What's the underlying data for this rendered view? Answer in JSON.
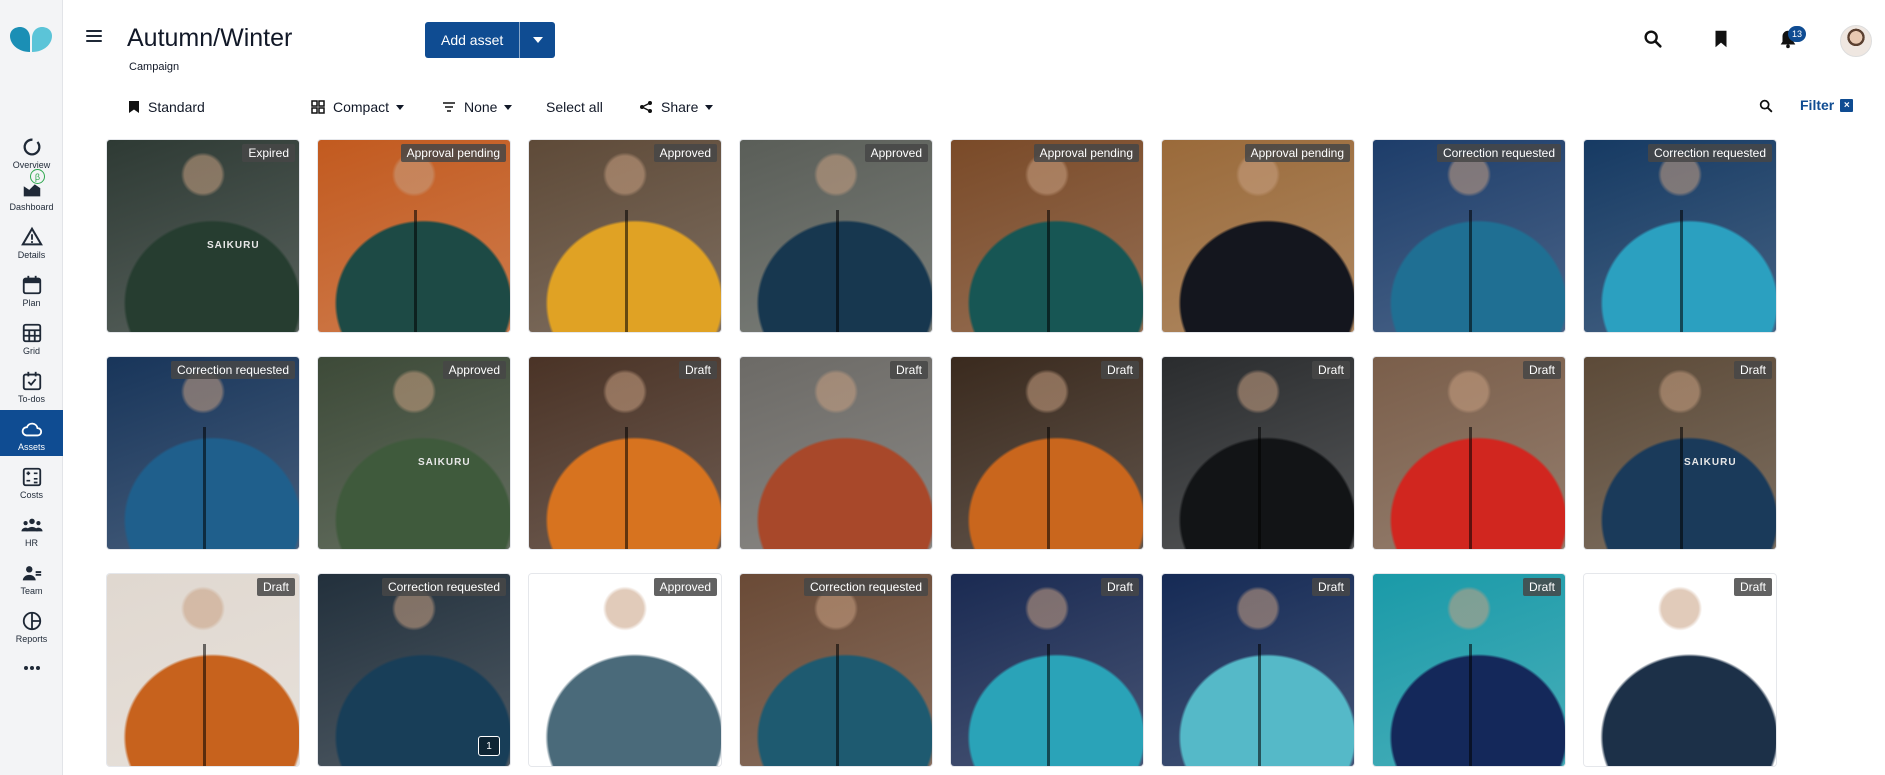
{
  "sidebar": {
    "items": [
      {
        "label": "Overview",
        "icon": "overview-icon"
      },
      {
        "label": "Dashboard",
        "icon": "dashboard-icon"
      },
      {
        "label": "Details",
        "icon": "warning-icon"
      },
      {
        "label": "Plan",
        "icon": "calendar-icon"
      },
      {
        "label": "Grid",
        "icon": "grid-icon"
      },
      {
        "label": "To-dos",
        "icon": "todo-icon"
      },
      {
        "label": "Assets",
        "icon": "cloud-icon"
      },
      {
        "label": "Costs",
        "icon": "calculator-icon"
      },
      {
        "label": "HR",
        "icon": "people-icon"
      },
      {
        "label": "Team",
        "icon": "team-icon"
      },
      {
        "label": "Reports",
        "icon": "pie-icon"
      }
    ],
    "active": "Assets",
    "beta_label": "β"
  },
  "header": {
    "title": "Autumn/Winter",
    "subtitle": "Campaign",
    "add_asset_label": "Add asset",
    "notification_count": "13"
  },
  "toolbar": {
    "view_label": "Standard",
    "layout_label": "Compact",
    "group_label": "None",
    "select_all_label": "Select all",
    "share_label": "Share",
    "filter_label": "Filter",
    "filter_clear": "×"
  },
  "assets": [
    {
      "status": "Expired",
      "bg": "#2e3a34",
      "jacket": "#263d30",
      "zip": false,
      "brand": "SAIKURU"
    },
    {
      "status": "Approval pending",
      "bg": "#c25a1f",
      "jacket": "#1d4a45",
      "zip": true
    },
    {
      "status": "Approved",
      "bg": "#5e4a38",
      "jacket": "#e0a224",
      "zip": true
    },
    {
      "status": "Approved",
      "bg": "#5a5e58",
      "jacket": "#17374f",
      "zip": true
    },
    {
      "status": "Approval pending",
      "bg": "#7a4a28",
      "jacket": "#175654",
      "zip": true
    },
    {
      "status": "Approval pending",
      "bg": "#9a6a3a",
      "jacket": "#14161e",
      "zip": false
    },
    {
      "status": "Correction requested",
      "bg": "#1d3d6a",
      "jacket": "#1f6f93",
      "zip": true
    },
    {
      "status": "Correction requested",
      "bg": "#163a63",
      "jacket": "#2ba0c0",
      "zip": true
    },
    {
      "status": "Correction requested",
      "bg": "#18355a",
      "jacket": "#1f5f8c",
      "zip": true
    },
    {
      "status": "Approved",
      "bg": "#3d4a38",
      "jacket": "#3f5a3c",
      "zip": false,
      "brand": "SAIKURU"
    },
    {
      "status": "Draft",
      "bg": "#4a3326",
      "jacket": "#d7731f",
      "zip": true
    },
    {
      "status": "Draft",
      "bg": "#6c6a66",
      "jacket": "#a8482a",
      "zip": false
    },
    {
      "status": "Draft",
      "bg": "#3a2a1e",
      "jacket": "#c9661d",
      "zip": true
    },
    {
      "status": "Draft",
      "bg": "#2a2c2e",
      "jacket": "#121416",
      "zip": true
    },
    {
      "status": "Draft",
      "bg": "#7a5e4a",
      "jacket": "#d1261f",
      "zip": true
    },
    {
      "status": "Draft",
      "bg": "#5c4a38",
      "jacket": "#1a3a5a",
      "zip": true,
      "brand": "SAIKURU"
    },
    {
      "status": "Draft",
      "bg": "#e0d8d0",
      "jacket": "#c7621d",
      "zip": true
    },
    {
      "status": "Correction requested",
      "bg": "#22303c",
      "jacket": "#183e58",
      "zip": false,
      "comments": "1"
    },
    {
      "status": "Approved",
      "bg": "#ffffff",
      "jacket": "#4a6a7a",
      "zip": false
    },
    {
      "status": "Correction requested",
      "bg": "#6a4a36",
      "jacket": "#1e5a70",
      "zip": true
    },
    {
      "status": "Draft",
      "bg": "#1a2a52",
      "jacket": "#2aa3b8",
      "zip": true
    },
    {
      "status": "Draft",
      "bg": "#152a55",
      "jacket": "#55b9c8",
      "zip": true
    },
    {
      "status": "Draft",
      "bg": "#1a9aa8",
      "jacket": "#14285a",
      "zip": true
    },
    {
      "status": "Draft",
      "bg": "#ffffff",
      "jacket": "#1c3048",
      "zip": false
    }
  ]
}
